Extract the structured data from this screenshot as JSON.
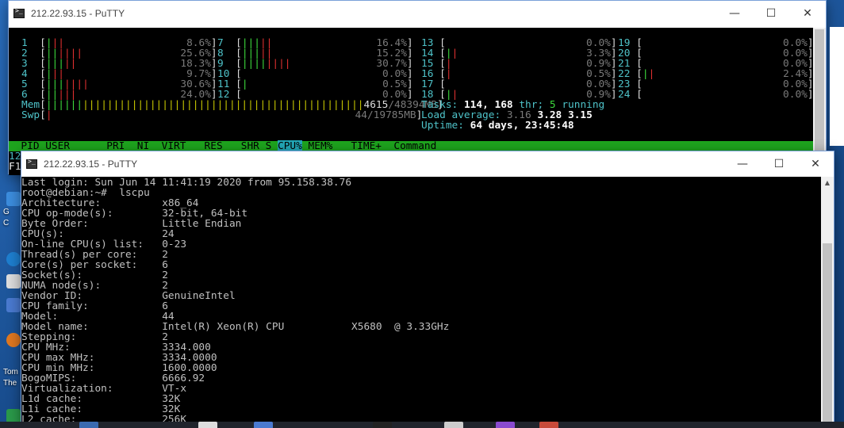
{
  "back_window": {
    "title": "212.22.93.15 - PuTTY",
    "cpus_left": [
      {
        "id": "1",
        "pct": "8.6%",
        "g": 1,
        "r": 2
      },
      {
        "id": "2",
        "pct": "25.6%",
        "g": 2,
        "r": 4
      },
      {
        "id": "3",
        "pct": "18.3%",
        "g": 3,
        "r": 2
      },
      {
        "id": "4",
        "pct": "9.7%",
        "g": 1,
        "r": 2
      },
      {
        "id": "5",
        "pct": "30.6%",
        "g": 3,
        "r": 4
      },
      {
        "id": "6",
        "pct": "24.0%",
        "g": 2,
        "r": 3
      }
    ],
    "cpus_mid": [
      {
        "id": "7",
        "pct": "16.4%",
        "g": 3,
        "r": 2
      },
      {
        "id": "8",
        "pct": "15.2%",
        "g": 3,
        "r": 2
      },
      {
        "id": "9",
        "pct": "30.7%",
        "g": 4,
        "r": 4
      },
      {
        "id": "10",
        "pct": "0.0%",
        "g": 0,
        "r": 0
      },
      {
        "id": "11",
        "pct": "0.5%",
        "g": 1,
        "r": 0
      },
      {
        "id": "12",
        "pct": "0.0%",
        "g": 0,
        "r": 0
      }
    ],
    "cpus_right": [
      {
        "id": "13",
        "pct": "0.0%",
        "g": 0,
        "r": 0
      },
      {
        "id": "14",
        "pct": "3.3%",
        "g": 1,
        "r": 1
      },
      {
        "id": "15",
        "pct": "0.9%",
        "g": 0,
        "r": 1
      },
      {
        "id": "16",
        "pct": "0.5%",
        "g": 0,
        "r": 1
      },
      {
        "id": "17",
        "pct": "0.0%",
        "g": 0,
        "r": 0
      },
      {
        "id": "18",
        "pct": "0.9%",
        "g": 1,
        "r": 1
      }
    ],
    "cpus_far": [
      {
        "id": "19",
        "pct": "0.0%",
        "g": 0,
        "r": 0
      },
      {
        "id": "20",
        "pct": "0.0%",
        "g": 0,
        "r": 0
      },
      {
        "id": "21",
        "pct": "0.0%",
        "g": 0,
        "r": 0
      },
      {
        "id": "22",
        "pct": "2.4%",
        "g": 1,
        "r": 1
      },
      {
        "id": "23",
        "pct": "0.0%",
        "g": 0,
        "r": 0
      },
      {
        "id": "24",
        "pct": "0.0%",
        "g": 0,
        "r": 0
      }
    ],
    "mem_label": "Mem",
    "mem_value": "4615/48394MB",
    "mem_used": "4615",
    "mem_total": "/48394MB",
    "swp_label": "Swp",
    "swp_value": "44/19785MB",
    "tasks_label": "Tasks:",
    "tasks_value": "114,",
    "thr_value": "168",
    "thr_label": "thr;",
    "running_value": "5",
    "running_label": "running",
    "load_label": "Load average:",
    "load_1": "3.16",
    "load_5": "3.28",
    "load_15": "3.15",
    "uptime_label": "Uptime:",
    "uptime_value": "64 days, 23:45:48",
    "header_cols_pre": "  PID USER      PRI  NI  VIRT   RES   SHR S ",
    "header_sel": "CPU%",
    "header_cols_post": " MEM%   TIME+  Command",
    "peek_rows": [
      "12",
      "F1"
    ]
  },
  "front_window": {
    "title": "212.22.93.15 - PuTTY",
    "lines": [
      "Last login: Sun Jun 14 11:41:19 2020 from 95.158.38.76",
      "root@debian:~#  lscpu",
      "Architecture:          x86_64",
      "CPU op-mode(s):        32-bit, 64-bit",
      "Byte Order:            Little Endian",
      "CPU(s):                24",
      "On-line CPU(s) list:   0-23",
      "Thread(s) per core:    2",
      "Core(s) per socket:    6",
      "Socket(s):             2",
      "NUMA node(s):          2",
      "Vendor ID:             GenuineIntel",
      "CPU family:            6",
      "Model:                 44",
      "Model name:            Intel(R) Xeon(R) CPU           X5680  @ 3.33GHz",
      "Stepping:              2",
      "CPU MHz:               3334.000",
      "CPU max MHz:           3334.0000",
      "CPU min MHz:           1600.0000",
      "BogoMIPS:              6666.92",
      "Virtualization:        VT-x",
      "L1d cache:             32K",
      "L1i cache:             32K",
      "L2 cache:              256K"
    ]
  },
  "desktop": {
    "labels": [
      "G",
      "C",
      "Tom",
      "The"
    ]
  },
  "controls": {
    "minimize": "—",
    "maximize": "☐",
    "close": "✕"
  }
}
